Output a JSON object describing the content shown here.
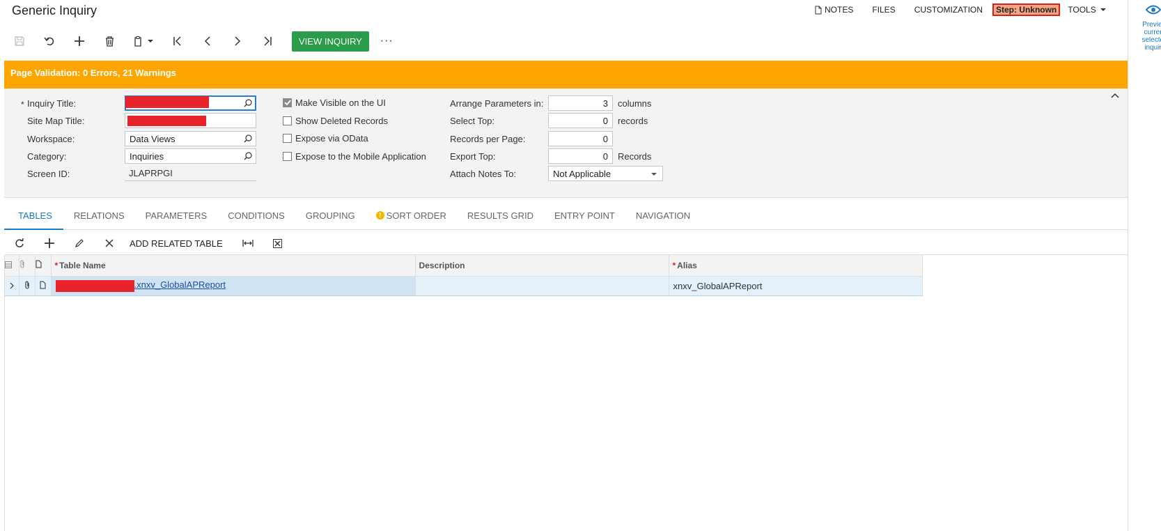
{
  "page_title": "Generic Inquiry",
  "top_menu": {
    "notes": "NOTES",
    "files": "FILES",
    "customization": "CUSTOMIZATION",
    "step": "Step: Unknown",
    "tools": "TOOLS"
  },
  "right_pane": {
    "preview_text": "Preview current selected inquiry"
  },
  "toolbar": {
    "view_inquiry": "VIEW INQUIRY",
    "more": "···",
    "icons": [
      "save-icon",
      "undo-icon",
      "add-icon",
      "delete-icon",
      "copy-paste-icon",
      "first-record-icon",
      "previous-record-icon",
      "next-record-icon",
      "last-record-icon"
    ]
  },
  "validation": {
    "text": "Page Validation: 0 Errors, 21 Warnings",
    "color": "#ffa500"
  },
  "form": {
    "inquiry_title": {
      "label": "Inquiry Title:",
      "required": "*",
      "value": ""
    },
    "site_map_title": {
      "label": "Site Map Title:",
      "value": ""
    },
    "workspace": {
      "label": "Workspace:",
      "value": "Data Views"
    },
    "category": {
      "label": "Category:",
      "value": "Inquiries"
    },
    "screen_id": {
      "label": "Screen ID:",
      "value": "JLAPRPGI"
    },
    "make_visible": {
      "label": "Make Visible on the UI",
      "checked": true
    },
    "show_deleted": {
      "label": "Show Deleted Records",
      "checked": false
    },
    "expose_odata": {
      "label": "Expose via OData",
      "checked": false
    },
    "expose_mobile": {
      "label": "Expose to the Mobile Application",
      "checked": false
    },
    "arrange_params": {
      "label": "Arrange Parameters in:",
      "value": "3",
      "unit": "columns"
    },
    "select_top": {
      "label": "Select Top:",
      "value": "0",
      "unit": "records"
    },
    "records_per_page": {
      "label": "Records per Page:",
      "value": "0"
    },
    "export_top": {
      "label": "Export Top:",
      "value": "0",
      "unit": "Records"
    },
    "attach_notes": {
      "label": "Attach Notes To:",
      "value": "Not Applicable"
    }
  },
  "tabs": [
    {
      "label": "TABLES",
      "active": true
    },
    {
      "label": "RELATIONS"
    },
    {
      "label": "PARAMETERS"
    },
    {
      "label": "CONDITIONS"
    },
    {
      "label": "GROUPING"
    },
    {
      "label": "SORT ORDER",
      "warning": "!"
    },
    {
      "label": "RESULTS GRID"
    },
    {
      "label": "ENTRY POINT"
    },
    {
      "label": "NAVIGATION"
    }
  ],
  "grid_toolbar": {
    "add_related_table": "ADD RELATED TABLE"
  },
  "grid": {
    "columns": {
      "table_name": "Table Name",
      "description": "Description",
      "alias": "Alias",
      "required": "*"
    },
    "rows": [
      {
        "table_name_suffix": ".xnxv_GlobalAPReport",
        "description": "",
        "alias": "xnxv_GlobalAPReport"
      }
    ]
  },
  "colors": {
    "accent": "#1a7ac2",
    "green_button": "#2a9d4a",
    "redaction": "#e8232a"
  }
}
